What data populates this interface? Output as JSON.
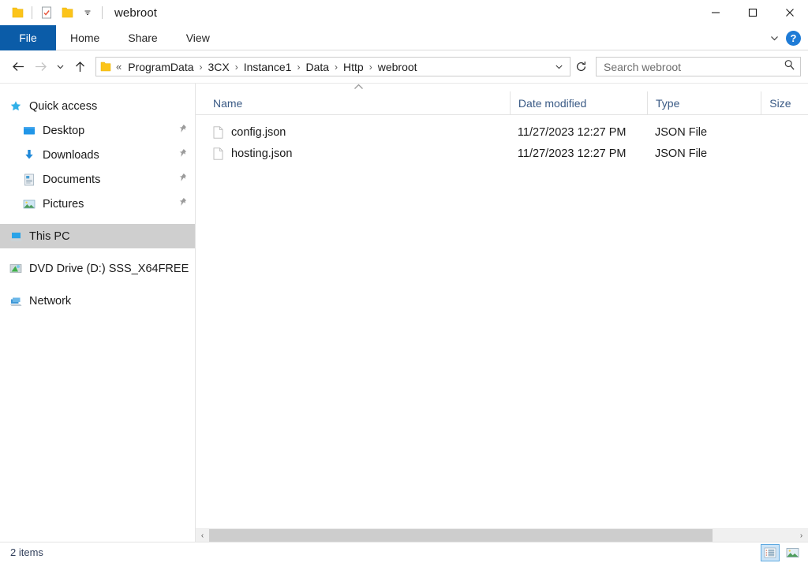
{
  "window": {
    "title": "webroot",
    "quick_access": [
      {
        "name": "folder-icon",
        "label": "Folder"
      },
      {
        "name": "properties-icon",
        "label": "Properties"
      },
      {
        "name": "new-folder-icon",
        "label": "New folder"
      },
      {
        "name": "customize-chevron-icon",
        "label": "Customize Quick Access Toolbar"
      }
    ],
    "controls": [
      {
        "name": "minimize-button",
        "glyph": "─"
      },
      {
        "name": "maximize-button",
        "glyph": "☐"
      },
      {
        "name": "close-button",
        "glyph": "✕"
      }
    ]
  },
  "ribbon": {
    "tabs": [
      {
        "label": "File",
        "active": true
      },
      {
        "label": "Home",
        "active": false
      },
      {
        "label": "Share",
        "active": false
      },
      {
        "label": "View",
        "active": false
      }
    ],
    "expand_label": "Expand the Ribbon",
    "help_label": "?"
  },
  "address": {
    "back_label": "Back",
    "forward_label": "Forward",
    "recent_label": "Recent locations",
    "up_label": "Up",
    "overflow": "«",
    "crumbs": [
      "ProgramData",
      "3CX",
      "Instance1",
      "Data",
      "Http",
      "webroot"
    ],
    "separator": "›",
    "dropdown_label": "Previous locations",
    "refresh_label": "Refresh"
  },
  "search": {
    "placeholder": "Search webroot",
    "icon": "search-icon"
  },
  "sidebar": {
    "items": [
      {
        "label": "Quick access",
        "icon": "star-icon",
        "indent": false,
        "pinned": false,
        "selected": false
      },
      {
        "label": "Desktop",
        "icon": "desktop-icon",
        "indent": true,
        "pinned": true,
        "selected": false
      },
      {
        "label": "Downloads",
        "icon": "downloads-icon",
        "indent": true,
        "pinned": true,
        "selected": false
      },
      {
        "label": "Documents",
        "icon": "documents-icon",
        "indent": true,
        "pinned": true,
        "selected": false
      },
      {
        "label": "Pictures",
        "icon": "pictures-icon",
        "indent": true,
        "pinned": true,
        "selected": false
      },
      {
        "label": "This PC",
        "icon": "this-pc-icon",
        "indent": false,
        "pinned": false,
        "selected": true
      },
      {
        "label": "DVD Drive (D:) SSS_X64FREE",
        "icon": "dvd-drive-icon",
        "indent": false,
        "pinned": false,
        "selected": false
      },
      {
        "label": "Network",
        "icon": "network-icon",
        "indent": false,
        "pinned": false,
        "selected": false
      }
    ]
  },
  "filelist": {
    "columns": [
      {
        "label": "Name",
        "sorted": "asc"
      },
      {
        "label": "Date modified",
        "sorted": ""
      },
      {
        "label": "Type",
        "sorted": ""
      },
      {
        "label": "Size",
        "sorted": ""
      }
    ],
    "rows": [
      {
        "name": "config.json",
        "date": "11/27/2023 12:27 PM",
        "type": "JSON File",
        "size": "",
        "icon": "file-icon"
      },
      {
        "name": "hosting.json",
        "date": "11/27/2023 12:27 PM",
        "type": "JSON File",
        "size": "",
        "icon": "file-icon"
      }
    ]
  },
  "scrollbar": {
    "left_arrow": "‹",
    "right_arrow": "›"
  },
  "statusbar": {
    "item_count": "2 items",
    "views": [
      {
        "name": "details-view-button",
        "label": "Details view",
        "active": true
      },
      {
        "name": "large-icons-view-button",
        "label": "Large icons view",
        "active": false
      }
    ]
  },
  "colors": {
    "accent": "#0b5ca8",
    "header_text": "#3a5a85",
    "selection": "#cfcfcf",
    "help_blue": "#1e7bd6"
  }
}
